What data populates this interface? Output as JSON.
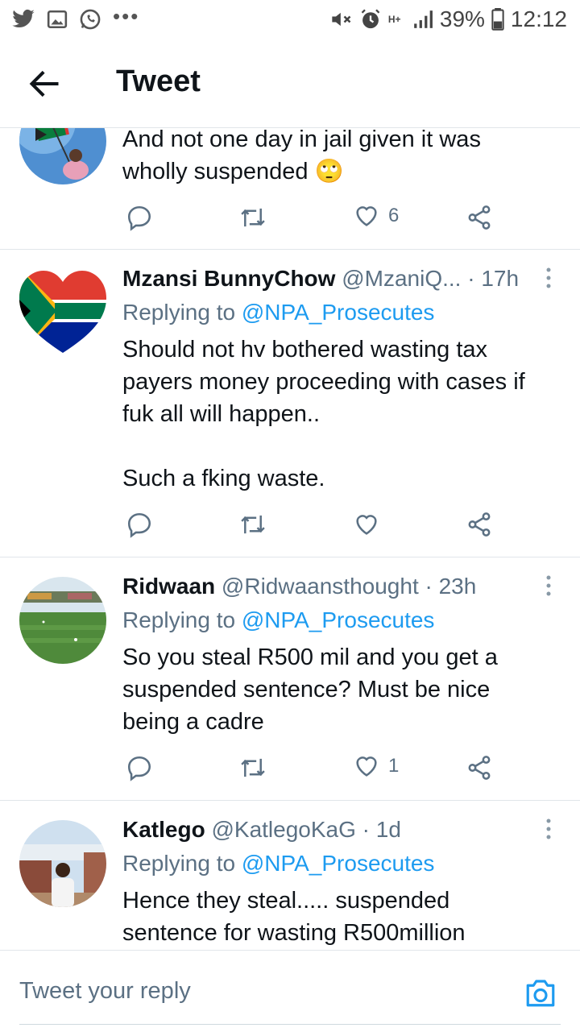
{
  "status_bar": {
    "battery": "39%",
    "time": "12:12",
    "network": "H+"
  },
  "header": {
    "title": "Tweet"
  },
  "tweets": [
    {
      "text_lines": [
        "And not one day in jail given it was",
        "wholly suspended 🙄"
      ],
      "like_count": "6"
    },
    {
      "name": "Mzansi BunnyChow",
      "handle": "@MzaniQ...",
      "time": "· 17h",
      "replying_prefix": "Replying to",
      "replying_to": "@NPA_Prosecutes",
      "text_lines": [
        "Should not hv bothered wasting tax",
        "payers money proceeding with cases if",
        "fuk all will happen..",
        "",
        "Such a fking waste."
      ]
    },
    {
      "name": "Ridwaan",
      "handle": "@Ridwaansthought",
      "time": "· 23h",
      "replying_prefix": "Replying to",
      "replying_to": "@NPA_Prosecutes",
      "text_lines": [
        "So you steal R500 mil and you get a",
        "suspended sentence? Must be nice",
        "being a cadre"
      ],
      "like_count": "1"
    },
    {
      "name": "Katlego",
      "handle": "@KatlegoKaG",
      "time": "· 1d",
      "replying_prefix": "Replying to",
      "replying_to": "@NPA_Prosecutes",
      "text_lines": [
        "Hence they steal..... suspended",
        "sentence for wasting R500million"
      ]
    }
  ],
  "composer": {
    "placeholder": "Tweet your reply"
  },
  "colors": {
    "accent": "#1d9bf0",
    "muted": "#5b7083"
  }
}
